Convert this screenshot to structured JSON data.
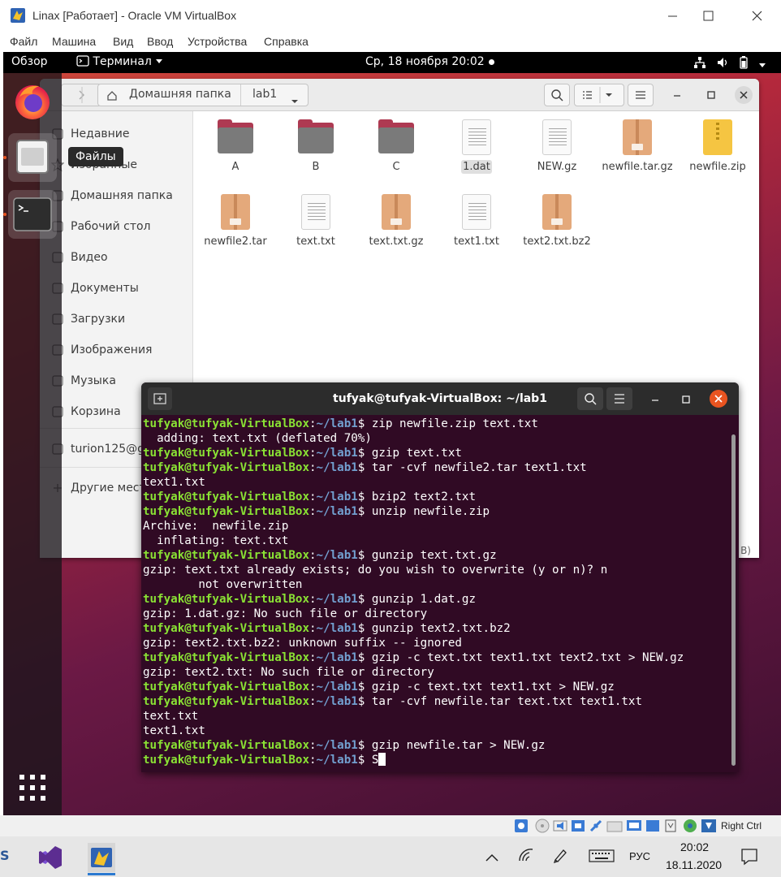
{
  "vbox": {
    "title": "Linax [Работает] - Oracle VM VirtualBox",
    "menu": [
      "Файл",
      "Машина",
      "Вид",
      "Ввод",
      "Устройства",
      "Справка"
    ],
    "host_key": "Right Ctrl"
  },
  "gnome": {
    "activities": "Обзор",
    "app_menu": "Терминал",
    "clock": "Ср, 18 ноября  20:02"
  },
  "dock": {
    "files_tooltip": "Файлы"
  },
  "files": {
    "path": [
      "Домашняя папка",
      "lab1"
    ],
    "sidebar": [
      {
        "label": "Недавние",
        "icon": "clock-icon"
      },
      {
        "label": "Избранные",
        "icon": "star-icon"
      },
      {
        "label": "Домашняя папка",
        "icon": "home-icon"
      },
      {
        "label": "Рабочий стол",
        "icon": "desktop-icon"
      },
      {
        "label": "Видео",
        "icon": "video-icon"
      },
      {
        "label": "Документы",
        "icon": "document-icon"
      },
      {
        "label": "Загрузки",
        "icon": "download-icon"
      },
      {
        "label": "Изображения",
        "icon": "image-icon"
      },
      {
        "label": "Музыка",
        "icon": "music-icon"
      },
      {
        "label": "Корзина",
        "icon": "trash-icon"
      },
      {
        "label": "turion125@gmail.com",
        "icon": "online-account-icon"
      },
      {
        "label": "Другие места",
        "icon": "plus-icon"
      }
    ],
    "items": [
      {
        "name": "A",
        "kind": "folder"
      },
      {
        "name": "B",
        "kind": "folder"
      },
      {
        "name": "C",
        "kind": "folder"
      },
      {
        "name": "1.dat",
        "kind": "text"
      },
      {
        "name": "NEW.gz",
        "kind": "text"
      },
      {
        "name": "newfile.tar.gz",
        "kind": "archive"
      },
      {
        "name": "newfile.zip",
        "kind": "zip"
      },
      {
        "name": "newfile2.tar",
        "kind": "archive"
      },
      {
        "name": "text.txt",
        "kind": "text"
      },
      {
        "name": "text.txt.gz",
        "kind": "archive"
      },
      {
        "name": "text1.txt",
        "kind": "text"
      },
      {
        "name": "text2.txt.bz2",
        "kind": "archive"
      }
    ],
    "statusbar_fragment": "B)"
  },
  "terminal": {
    "title": "tufyak@tufyak-VirtualBox: ~/lab1",
    "prompt_user": "tufyak@tufyak-VirtualBox",
    "prompt_path": "~/lab1",
    "lines": [
      {
        "t": "p",
        "cmd": "zip newfile.zip text.txt"
      },
      {
        "t": "o",
        "text": "  adding: text.txt (deflated 70%)"
      },
      {
        "t": "p",
        "cmd": "gzip text.txt"
      },
      {
        "t": "p",
        "cmd": "tar -cvf newfile2.tar text1.txt"
      },
      {
        "t": "o",
        "text": "text1.txt"
      },
      {
        "t": "p",
        "cmd": "bzip2 text2.txt"
      },
      {
        "t": "p",
        "cmd": "unzip newfile.zip"
      },
      {
        "t": "o",
        "text": "Archive:  newfile.zip"
      },
      {
        "t": "o",
        "text": "  inflating: text.txt"
      },
      {
        "t": "p",
        "cmd": "gunzip text.txt.gz"
      },
      {
        "t": "o",
        "text": "gzip: text.txt already exists; do you wish to overwrite (y or n)? n"
      },
      {
        "t": "o",
        "text": "        not overwritten"
      },
      {
        "t": "p",
        "cmd": "gunzip 1.dat.gz"
      },
      {
        "t": "o",
        "text": "gzip: 1.dat.gz: No such file or directory"
      },
      {
        "t": "p",
        "cmd": "gunzip text2.txt.bz2"
      },
      {
        "t": "o",
        "text": "gzip: text2.txt.bz2: unknown suffix -- ignored"
      },
      {
        "t": "p",
        "cmd": "gzip -c text.txt text1.txt text2.txt > NEW.gz"
      },
      {
        "t": "o",
        "text": "gzip: text2.txt: No such file or directory"
      },
      {
        "t": "p",
        "cmd": "gzip -c text.txt text1.txt > NEW.gz"
      },
      {
        "t": "p",
        "cmd": "tar -cvf newfile.tar text.txt text1.txt"
      },
      {
        "t": "o",
        "text": "text.txt"
      },
      {
        "t": "o",
        "text": "text1.txt"
      },
      {
        "t": "p",
        "cmd": "gzip newfile.tar > NEW.gz"
      },
      {
        "t": "p",
        "cmd": "S",
        "cursor": true
      }
    ]
  },
  "taskbar": {
    "lang": "РУС",
    "time": "20:02",
    "date": "18.11.2020",
    "left_fragment": "S"
  },
  "colors": {
    "prompt_user": "#8ae234",
    "prompt_path": "#729fcf",
    "terminal_bg": "#300a24",
    "close_orange": "#e95420"
  }
}
